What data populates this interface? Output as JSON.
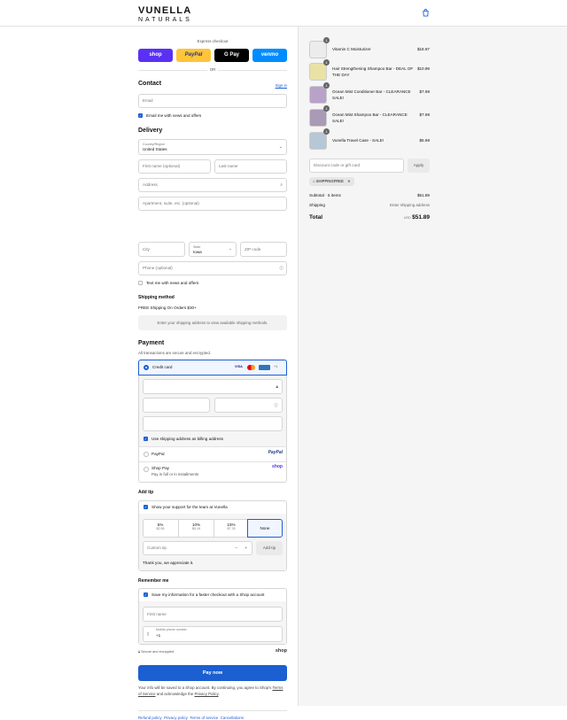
{
  "brand": {
    "line1": "VUNELLA",
    "line2": "NATURALS"
  },
  "express": {
    "label": "Express checkout",
    "buttons": [
      {
        "label": "shop",
        "color": "#5a31f4"
      },
      {
        "label": "PayPal",
        "color": "#ffc439"
      },
      {
        "label": "G Pay",
        "color": "#000000"
      },
      {
        "label": "venmo",
        "color": "#008cff"
      }
    ],
    "or": "OR"
  },
  "contact": {
    "title": "Contact",
    "signin": "Sign in",
    "email_placeholder": "Email",
    "news_label": "Email me with news and offers"
  },
  "delivery": {
    "title": "Delivery",
    "country_label": "Country/Region",
    "country_value": "United States",
    "first_name": "First name (optional)",
    "last_name": "Last name",
    "address": "Address",
    "apartment": "Apartment, suite, etc. (optional)",
    "city": "City",
    "state_label": "State",
    "state_value": "Iowa",
    "zip": "ZIP code",
    "phone": "Phone (optional)",
    "text_label": "Text me with news and offers"
  },
  "shipping": {
    "title": "Shipping method",
    "free_note": "FREE Shipping On Orders $30+",
    "placeholder": "Enter your shipping address to view available shipping methods."
  },
  "payment": {
    "title": "Payment",
    "subtitle": "All transactions are secure and encrypted.",
    "credit_card": "Credit card",
    "cards": [
      "VISA",
      "MC",
      "AMEX",
      "+1"
    ],
    "use_shipping": "Use shipping address as billing address",
    "paypal": "PayPal",
    "paypal_logo": "PayPal",
    "shoppay": "Shop Pay",
    "shoppay_sub": "Pay in full or in installments",
    "shoppay_logo": "shop"
  },
  "tip": {
    "title": "Add tip",
    "support": "Show your support for the team at Vunella",
    "options": [
      {
        "pct": "5%",
        "amt": "$2.59"
      },
      {
        "pct": "10%",
        "amt": "$5.19"
      },
      {
        "pct": "15%",
        "amt": "$7.78"
      },
      {
        "pct": "None",
        "amt": ""
      }
    ],
    "custom_placeholder": "Custom tip",
    "minus": "−",
    "plus": "+",
    "add_button": "Add tip",
    "thanks": "Thank you, we appreciate it."
  },
  "remember": {
    "title": "Remember me",
    "save_label": "Save my information for a faster checkout with a Shop account",
    "first_name": "First name",
    "mobile_label": "Mobile phone number",
    "mobile_value": "+1",
    "secure": "Secure and encrypted",
    "shop_logo": "shop"
  },
  "pay_button": "Pay now",
  "disclaimer": {
    "pre": "Your info will be saved to a Shop account. By continuing, you agree to Shop's",
    "terms": "Terms of Service",
    "mid": "and acknowledge the",
    "privacy": "Privacy Policy"
  },
  "footer_links": [
    "Refund policy",
    "Privacy policy",
    "Terms of service",
    "Cancellations"
  ],
  "order": {
    "items": [
      {
        "name": "Vitamin C Moisturizer",
        "qty": "1",
        "price": "$18.97",
        "color": "#ececec"
      },
      {
        "name": "Hair Strengthening Shampoo Bar - DEAL OF THE DAY",
        "qty": "1",
        "price": "$10.99",
        "color": "#e8e2a6"
      },
      {
        "name": "Ocean Mist Conditioner Bar - CLEARANCE SALE!",
        "qty": "1",
        "price": "$7.98",
        "color": "#b9a2c9"
      },
      {
        "name": "Ocean Mist Shampoo Bar - CLEARANCE SALE!",
        "qty": "1",
        "price": "$7.98",
        "color": "#a99ab5"
      },
      {
        "name": "Vunella Travel Case - SALE!",
        "qty": "1",
        "price": "$5.98",
        "color": "#b8c7d6"
      }
    ],
    "discount_placeholder": "Discount code or gift card",
    "apply": "Apply",
    "code": "SHIPPINGFREE",
    "subtotal_label": "Subtotal · 5 items",
    "subtotal_value": "$51.89",
    "shipping_label": "Shipping",
    "shipping_value": "Enter shipping address",
    "total_label": "Total",
    "currency": "USD",
    "total_value": "$51.89"
  }
}
